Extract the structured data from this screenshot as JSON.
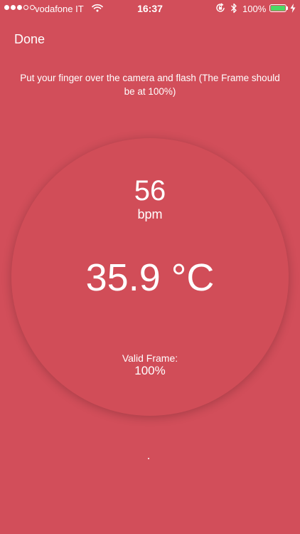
{
  "status_bar": {
    "carrier": "vodafone IT",
    "time": "16:37",
    "battery_percent": "100%",
    "signal_bars_filled": 3,
    "signal_bars_total": 5,
    "battery_level": 1.0,
    "battery_color": "#4cd964",
    "icons": [
      "wifi-icon",
      "rotation-lock-icon",
      "bluetooth-icon",
      "battery-icon",
      "charging-icon"
    ]
  },
  "nav": {
    "done_label": "Done"
  },
  "instruction": "Put your finger over the camera and flash (The Frame should be at 100%)",
  "readout": {
    "bpm_value": "56",
    "bpm_unit": "bpm",
    "temperature": "35.9 °C",
    "frame_label": "Valid Frame:",
    "frame_value": "100%"
  },
  "colors": {
    "background": "#d24e5a",
    "text": "#ffffff"
  }
}
